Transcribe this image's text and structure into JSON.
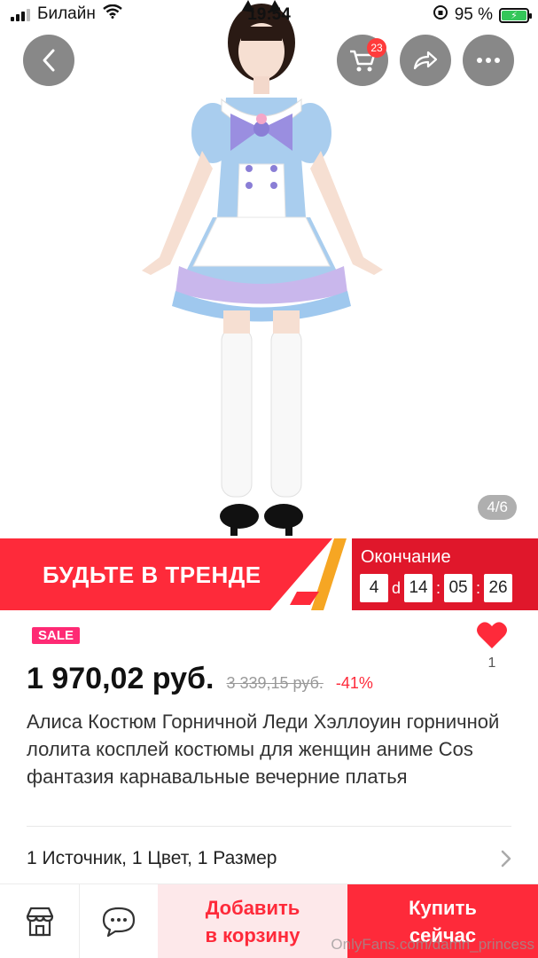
{
  "status_bar": {
    "carrier": "Билайн",
    "time": "19:54",
    "battery": "95 %"
  },
  "gallery": {
    "cart_count": "23",
    "counter": "4/6"
  },
  "banner": {
    "title": "БУДЬТЕ В ТРЕНДЕ",
    "ending_label": "Окончание",
    "countdown": {
      "days": "4",
      "day_unit": "d",
      "hours": "14",
      "minutes": "05",
      "seconds": "26"
    }
  },
  "product": {
    "sale_badge": "SALE",
    "favorites_count": "1",
    "price": "1 970,02 руб.",
    "old_price": "3 339,15 руб.",
    "discount": "-41%",
    "title": "Алиса Костюм Горничной Леди Хэллоуин горничной лолита косплей костюмы для женщин аниме Cos фантазия карнавальные вечерние платья",
    "options": "1 Источник, 1 Цвет, 1 Размер"
  },
  "bottom_bar": {
    "add_to_cart_line1": "Добавить",
    "add_to_cart_line2": "в корзину",
    "buy_now_line1": "Купить",
    "buy_now_line2": "сейчас"
  },
  "watermark": "OnlyFans.com/damn_princess",
  "colors": {
    "accent": "#fe2a3a",
    "sale": "#fe2a74",
    "cart_button_bg": "#fde8ea"
  },
  "icons": [
    "back-icon",
    "cart-icon",
    "share-icon",
    "more-icon",
    "heart-icon",
    "chevron-right-icon",
    "store-icon",
    "chat-icon"
  ]
}
